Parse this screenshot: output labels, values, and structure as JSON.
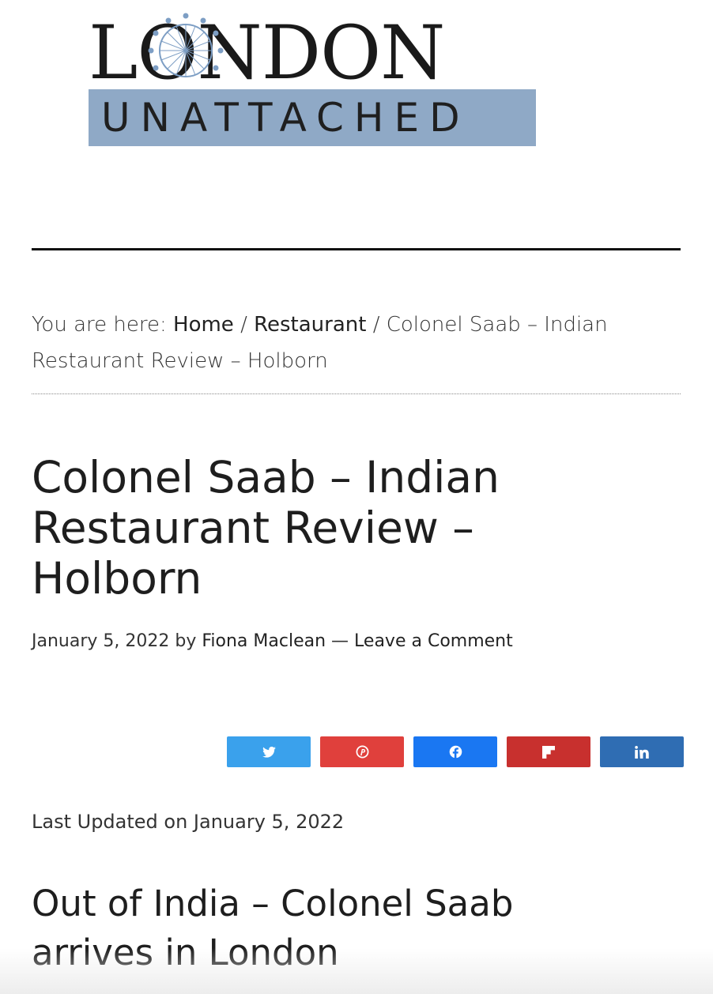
{
  "logo": {
    "top_text": "LONDON",
    "bottom_text": "UNATTACHED"
  },
  "breadcrumb": {
    "prefix": "You are here:",
    "items": [
      {
        "label": "Home"
      },
      {
        "label": "Restaurant"
      }
    ],
    "separator": "/",
    "current": "Colonel Saab – Indian Restaurant Review – Holborn"
  },
  "article": {
    "title": "Colonel Saab – Indian Restaurant Review – Holborn",
    "date": "January 5, 2022",
    "by": "by",
    "author": "Fiona Maclean",
    "dash": "—",
    "comment_link": "Leave a Comment",
    "last_updated": "Last Updated on January 5, 2022",
    "subheading": "Out of India – Colonel Saab arrives in London"
  },
  "share": [
    {
      "name": "twitter",
      "icon": "twitter-icon",
      "color": "#3aa1ec"
    },
    {
      "name": "pinterest",
      "icon": "pinterest-icon",
      "color": "#e0403c"
    },
    {
      "name": "facebook",
      "icon": "facebook-icon",
      "color": "#1a77f2"
    },
    {
      "name": "flipboard",
      "icon": "flipboard-icon",
      "color": "#c8302e"
    },
    {
      "name": "linkedin",
      "icon": "linkedin-icon",
      "color": "#2f6db3"
    }
  ],
  "colors": {
    "logo_band": "#8fa9c6",
    "logo_dots": "#7d9ec4"
  }
}
